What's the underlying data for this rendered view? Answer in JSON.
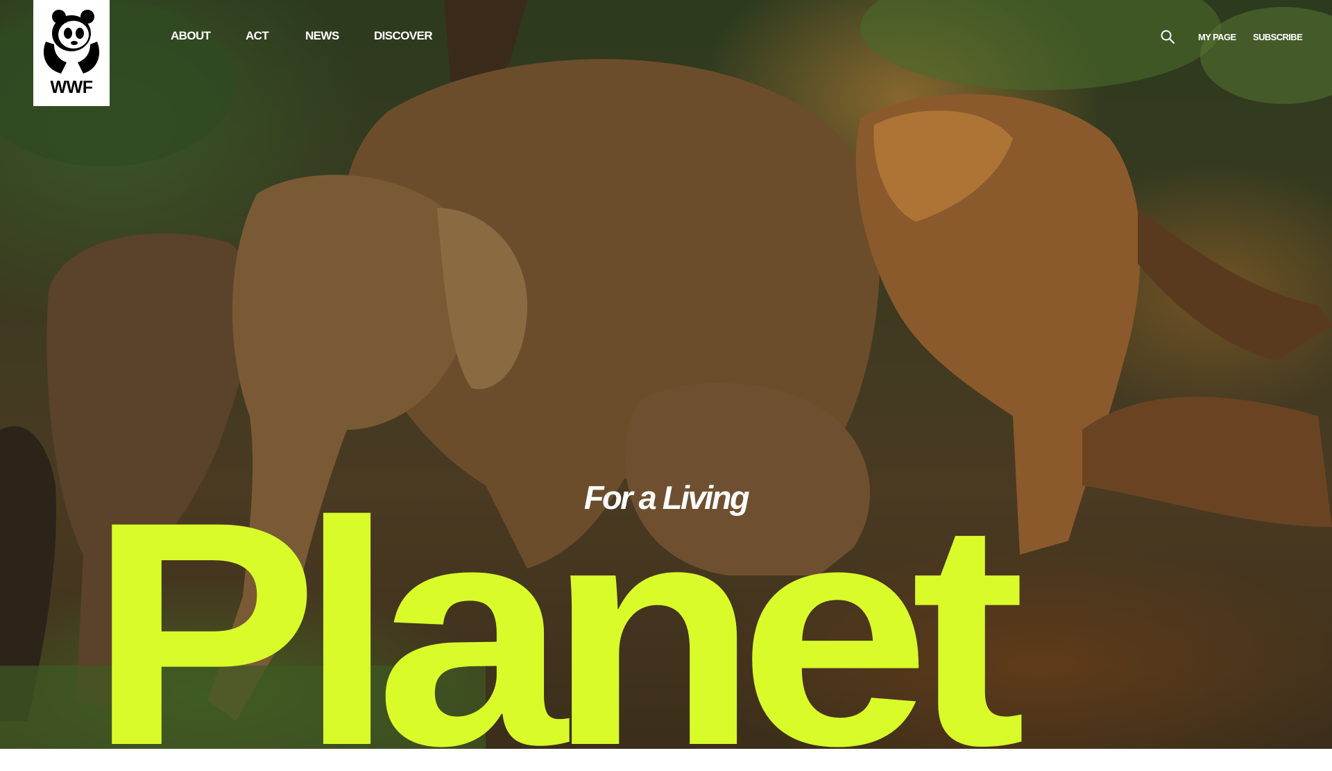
{
  "logo": {
    "text": "WWF",
    "icon": "panda-logo-icon"
  },
  "nav": {
    "items": [
      {
        "label": "ABOUT"
      },
      {
        "label": "ACT"
      },
      {
        "label": "NEWS"
      },
      {
        "label": "DISCOVER"
      }
    ]
  },
  "utility": {
    "search_icon": "search-icon",
    "my_page_label": "MY PAGE",
    "subscribe_label": "SUBSCRIBE"
  },
  "hero": {
    "tagline": "For a Living",
    "headline": "Planet",
    "headline_color": "#d9fb2a",
    "image_subject": "elephant herd photo"
  }
}
